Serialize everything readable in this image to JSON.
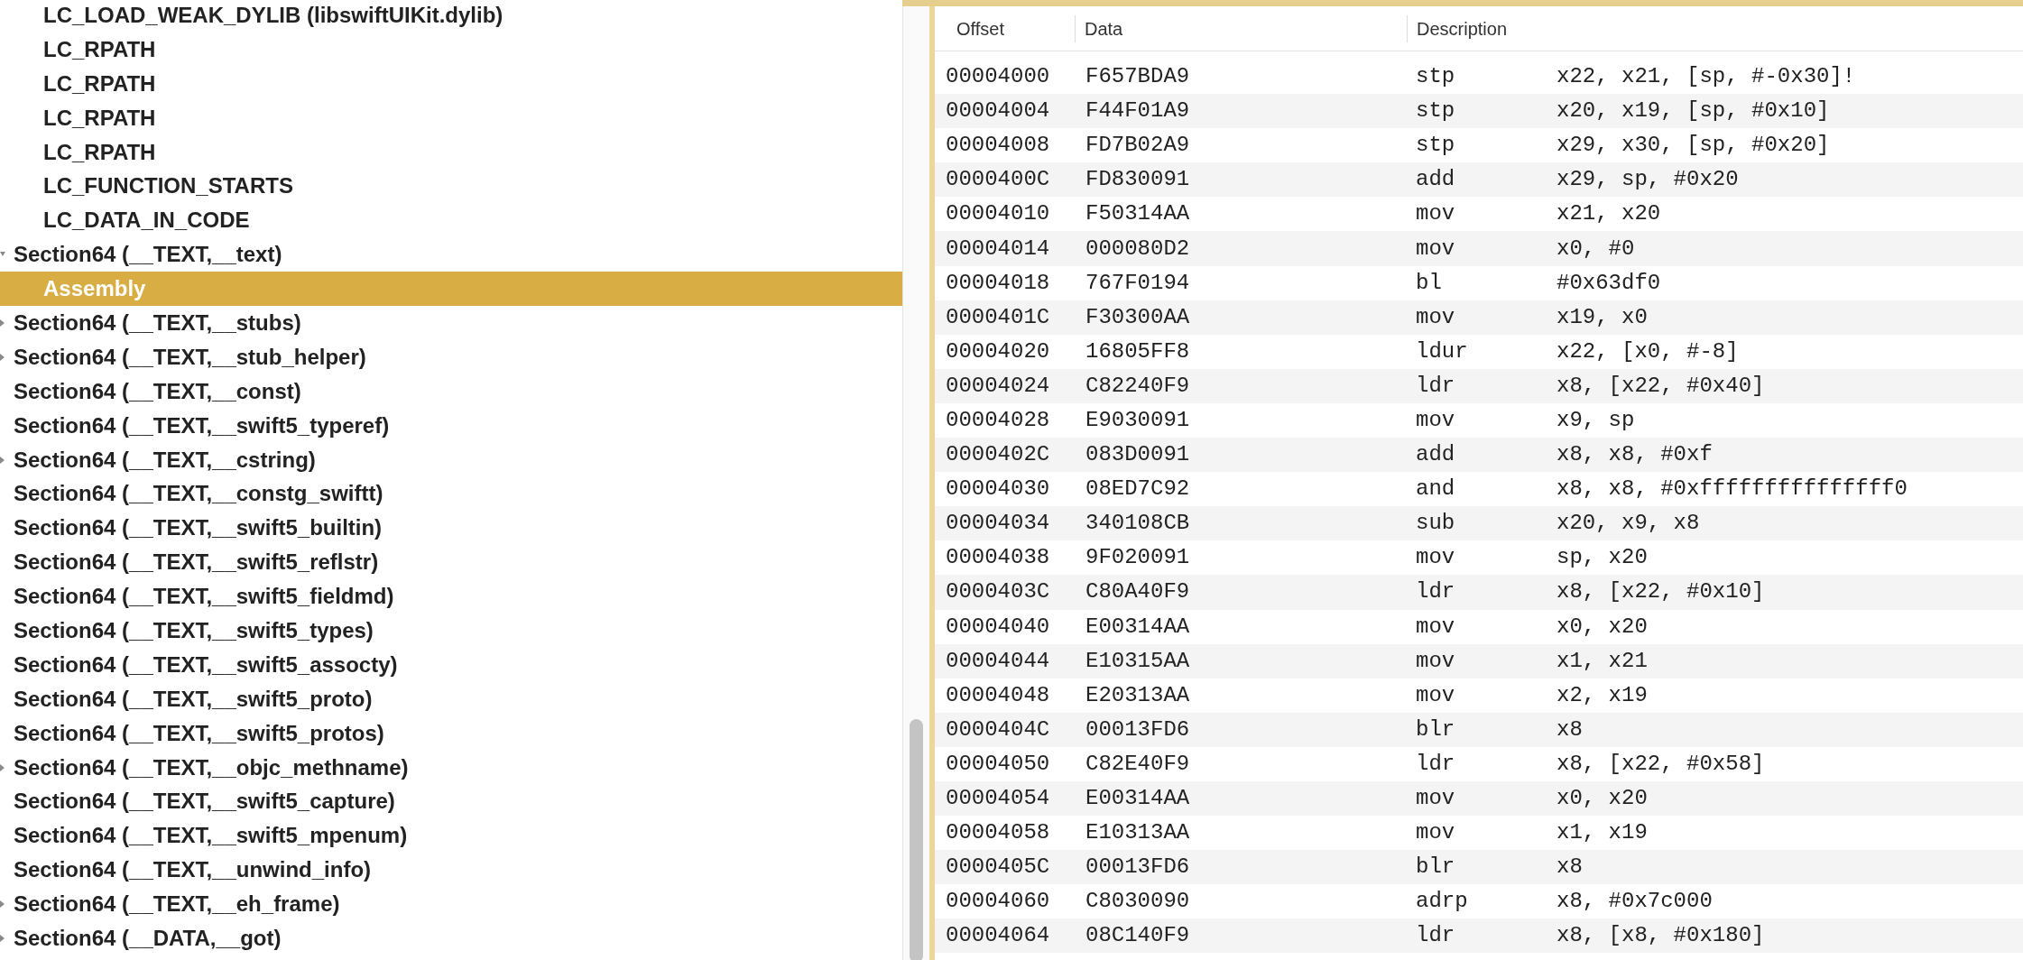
{
  "tree": [
    {
      "children": [
        {
          "label": "LC_LOAD_WEAK_DYLIB (libswiftUIKit.dylib)",
          "selected": false
        },
        {
          "label": "LC_RPATH",
          "selected": false
        },
        {
          "label": "LC_RPATH",
          "selected": false
        },
        {
          "label": "LC_RPATH",
          "selected": false
        },
        {
          "label": "LC_RPATH",
          "selected": false
        },
        {
          "label": "LC_FUNCTION_STARTS",
          "selected": false
        },
        {
          "label": "LC_DATA_IN_CODE",
          "selected": false
        }
      ]
    },
    {
      "label": "Section64 (__TEXT,__text)",
      "selected": false,
      "expanded": true,
      "children": [
        {
          "label": "Assembly",
          "selected": true
        }
      ]
    },
    {
      "label": "Section64 (__TEXT,__stubs)",
      "selected": false,
      "expanded": false
    },
    {
      "label": "Section64 (__TEXT,__stub_helper)",
      "selected": false,
      "expanded": false
    },
    {
      "label": "Section64 (__TEXT,__const)",
      "selected": false
    },
    {
      "label": "Section64 (__TEXT,__swift5_typeref)",
      "selected": false
    },
    {
      "label": "Section64 (__TEXT,__cstring)",
      "selected": false,
      "expanded": false
    },
    {
      "label": "Section64 (__TEXT,__constg_swiftt)",
      "selected": false
    },
    {
      "label": "Section64 (__TEXT,__swift5_builtin)",
      "selected": false
    },
    {
      "label": "Section64 (__TEXT,__swift5_reflstr)",
      "selected": false
    },
    {
      "label": "Section64 (__TEXT,__swift5_fieldmd)",
      "selected": false
    },
    {
      "label": "Section64 (__TEXT,__swift5_types)",
      "selected": false
    },
    {
      "label": "Section64 (__TEXT,__swift5_assocty)",
      "selected": false
    },
    {
      "label": "Section64 (__TEXT,__swift5_proto)",
      "selected": false
    },
    {
      "label": "Section64 (__TEXT,__swift5_protos)",
      "selected": false
    },
    {
      "label": "Section64 (__TEXT,__objc_methname)",
      "selected": false,
      "expanded": false
    },
    {
      "label": "Section64 (__TEXT,__swift5_capture)",
      "selected": false
    },
    {
      "label": "Section64 (__TEXT,__swift5_mpenum)",
      "selected": false
    },
    {
      "label": "Section64 (__TEXT,__unwind_info)",
      "selected": false
    },
    {
      "label": "Section64 (__TEXT,__eh_frame)",
      "selected": false,
      "expanded": false
    },
    {
      "label": "Section64 (__DATA,__got)",
      "selected": false,
      "expanded": false
    }
  ],
  "table": {
    "columns": [
      "Offset",
      "Data",
      "Description"
    ],
    "rows": [
      [
        "00004000",
        "F657BDA9",
        "stp",
        "x22, x21, [sp, #-0x30]!"
      ],
      [
        "00004004",
        "F44F01A9",
        "stp",
        "x20, x19, [sp, #0x10]"
      ],
      [
        "00004008",
        "FD7B02A9",
        "stp",
        "x29, x30, [sp, #0x20]"
      ],
      [
        "0000400C",
        "FD830091",
        "add",
        "x29, sp, #0x20"
      ],
      [
        "00004010",
        "F50314AA",
        "mov",
        "x21, x20"
      ],
      [
        "00004014",
        "000080D2",
        "mov",
        "x0, #0"
      ],
      [
        "00004018",
        "767F0194",
        "bl",
        "#0x63df0"
      ],
      [
        "0000401C",
        "F30300AA",
        "mov",
        "x19, x0"
      ],
      [
        "00004020",
        "16805FF8",
        "ldur",
        "x22, [x0, #-8]"
      ],
      [
        "00004024",
        "C82240F9",
        "ldr",
        "x8, [x22, #0x40]"
      ],
      [
        "00004028",
        "E9030091",
        "mov",
        "x9, sp"
      ],
      [
        "0000402C",
        "083D0091",
        "add",
        "x8, x8, #0xf"
      ],
      [
        "00004030",
        "08ED7C92",
        "and",
        "x8, x8, #0xfffffffffffffff0"
      ],
      [
        "00004034",
        "340108CB",
        "sub",
        "x20, x9, x8"
      ],
      [
        "00004038",
        "9F020091",
        "mov",
        "sp, x20"
      ],
      [
        "0000403C",
        "C80A40F9",
        "ldr",
        "x8, [x22, #0x10]"
      ],
      [
        "00004040",
        "E00314AA",
        "mov",
        "x0, x20"
      ],
      [
        "00004044",
        "E10315AA",
        "mov",
        "x1, x21"
      ],
      [
        "00004048",
        "E20313AA",
        "mov",
        "x2, x19"
      ],
      [
        "0000404C",
        "00013FD6",
        "blr",
        "x8"
      ],
      [
        "00004050",
        "C82E40F9",
        "ldr",
        "x8, [x22, #0x58]"
      ],
      [
        "00004054",
        "E00314AA",
        "mov",
        "x0, x20"
      ],
      [
        "00004058",
        "E10313AA",
        "mov",
        "x1, x19"
      ],
      [
        "0000405C",
        "00013FD6",
        "blr",
        "x8"
      ],
      [
        "00004060",
        "C8030090",
        "adrp",
        "x8, #0x7c000"
      ],
      [
        "00004064",
        "08C140F9",
        "ldr",
        "x8, [x8, #0x180]"
      ]
    ]
  }
}
